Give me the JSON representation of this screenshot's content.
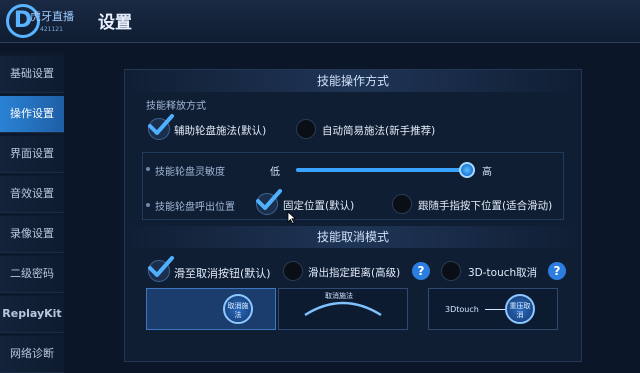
{
  "header": {
    "logo_text": "虎牙直播",
    "logo_sub": "421121",
    "title": "设置"
  },
  "sidebar": {
    "items": [
      {
        "label": "基础设置"
      },
      {
        "label": "操作设置"
      },
      {
        "label": "界面设置"
      },
      {
        "label": "音效设置"
      },
      {
        "label": "录像设置"
      },
      {
        "label": "二级密码"
      },
      {
        "label": "ReplayKit"
      },
      {
        "label": "网络诊断"
      }
    ],
    "active": "操作设置"
  },
  "skill_operation": {
    "section_title": "技能操作方式",
    "release_label": "技能释放方式",
    "options": [
      {
        "label": "辅助轮盘施法(默认)",
        "checked": true
      },
      {
        "label": "自动简易施法(新手推荐)",
        "checked": false
      }
    ],
    "sensitivity": {
      "label": "技能轮盘灵敏度",
      "low": "低",
      "high": "高",
      "value_percent": 97
    },
    "wheel_position": {
      "label": "技能轮盘呼出位置",
      "options": [
        {
          "label": "固定位置(默认)",
          "checked": true
        },
        {
          "label": "跟随手指按下位置(适合滑动)",
          "checked": false
        }
      ]
    }
  },
  "skill_cancel": {
    "section_title": "技能取消模式",
    "options": [
      {
        "label": "滑至取消按钮(默认)",
        "checked": true
      },
      {
        "label": "滑出指定距离(高级)",
        "checked": false
      },
      {
        "label": "3D-touch取消",
        "checked": false
      }
    ],
    "help": "?",
    "previews": {
      "cancel_btn": "取消施法",
      "arc_label": "取消施法",
      "touch_label": "3Dtouch",
      "press_btn": "重压取消"
    }
  },
  "colors": {
    "accent": "#2a82d4",
    "active_tab": "#1f5fa6",
    "background": "#0b1729"
  }
}
